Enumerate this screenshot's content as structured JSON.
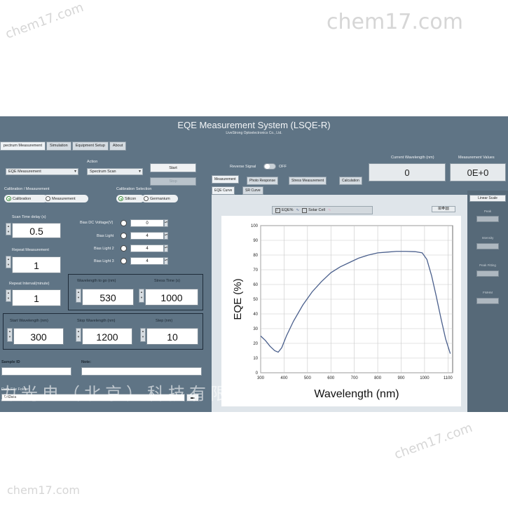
{
  "watermarks": {
    "main": "chem17.com",
    "repeat": "chem17.com",
    "company_line": "力光电（北京）科技有限公司"
  },
  "window": {
    "title": "EQE Measurement System  (LSQE-R)",
    "subtitle": "LiveStrong Optoelectronics Co., Ltd."
  },
  "tabs": [
    "pectrum Measurement",
    "Simulation",
    "Equipment Setup",
    "About"
  ],
  "left": {
    "mode_select": "EQE Measurement",
    "action_label": "Action",
    "action_select": "Spectrum Scan",
    "start_label": "Start",
    "stop_label": "Stop",
    "cal_meas_label": "Calibration / Measurement",
    "calibration_label": "Calibration",
    "measurement_label": "Measurement",
    "cal_selection_label": "Calibration Selection",
    "silicon_label": "Silicon",
    "germanium_label": "Germanium",
    "scan_time_label": "Scan Time delay (s)",
    "scan_time_value": "0.5",
    "repeat_label": "Repeat Measurement",
    "repeat_value": "1",
    "repeat_interval_label": "Repeat Interval(minute)",
    "repeat_interval_value": "1",
    "bias": [
      {
        "label": "Bias DC Voltage(V)",
        "value": "0"
      },
      {
        "label": "Bias Light",
        "value": "4"
      },
      {
        "label": "Bias Light 2",
        "value": "4"
      },
      {
        "label": "Bias Light 3",
        "value": "4"
      }
    ],
    "wl_to_go_label": "Wavelength to go (nm)",
    "wl_to_go_value": "530",
    "stress_time_label": "Stress Time (s)",
    "stress_time_value": "1000",
    "start_wl_label": "Start Wavelength (nm)",
    "start_wl_value": "300",
    "stop_wl_label": "Stop Wavelength (nm)",
    "stop_wl_value": "1200",
    "step_label": "Step (nm)",
    "step_value": "10",
    "sample_id_label": "Sample ID",
    "note_label": "Note:",
    "data_folder_label": "Data File Folder",
    "data_folder_value": "D:\\Data"
  },
  "right": {
    "reverse_signal_label": "Reverse Signal",
    "reverse_signal_state": "OFF",
    "current_wl_label": "Current Wavelength (nm)",
    "current_wl_value": "0",
    "meas_values_label": "Measurement Values",
    "meas_values_value": "0E+0",
    "tabs": [
      "Measurement",
      "Photo Response",
      "Stress Measurement",
      "Calculation"
    ],
    "subtabs": [
      "EQE Curve",
      "SR Curve"
    ],
    "legend": [
      {
        "label": "EQE%",
        "checked": true
      },
      {
        "label": "Solar Cell",
        "checked": false
      }
    ],
    "side": {
      "scale_button": "Linear Scale",
      "labels": [
        "Peak",
        "Intensity",
        "Peak Fitting",
        "FWHM"
      ]
    }
  },
  "chart_data": {
    "type": "line",
    "title": "",
    "xlabel": "Wavelength (nm)",
    "ylabel": "EQE (%)",
    "xlim": [
      300,
      1120
    ],
    "ylim": [
      0,
      100
    ],
    "x_ticks": [
      300,
      400,
      500,
      600,
      700,
      800,
      900,
      1000,
      1100
    ],
    "y_ticks": [
      0,
      10,
      20,
      30,
      40,
      50,
      60,
      70,
      80,
      90,
      100
    ],
    "grid": true,
    "series": [
      {
        "name": "EQE%",
        "color": "#4a5f8c",
        "x": [
          300,
          320,
          340,
          360,
          375,
          390,
          410,
          440,
          480,
          520,
          560,
          600,
          640,
          680,
          720,
          760,
          800,
          840,
          880,
          920,
          960,
          990,
          1010,
          1030,
          1050,
          1070,
          1090,
          1110
        ],
        "y": [
          25,
          22,
          18,
          15,
          14,
          17,
          25,
          35,
          46,
          55,
          62,
          68,
          72,
          75,
          78,
          80,
          81.5,
          82,
          82.5,
          82.5,
          82.3,
          81.5,
          77,
          66,
          52,
          37,
          23,
          13
        ]
      }
    ]
  }
}
